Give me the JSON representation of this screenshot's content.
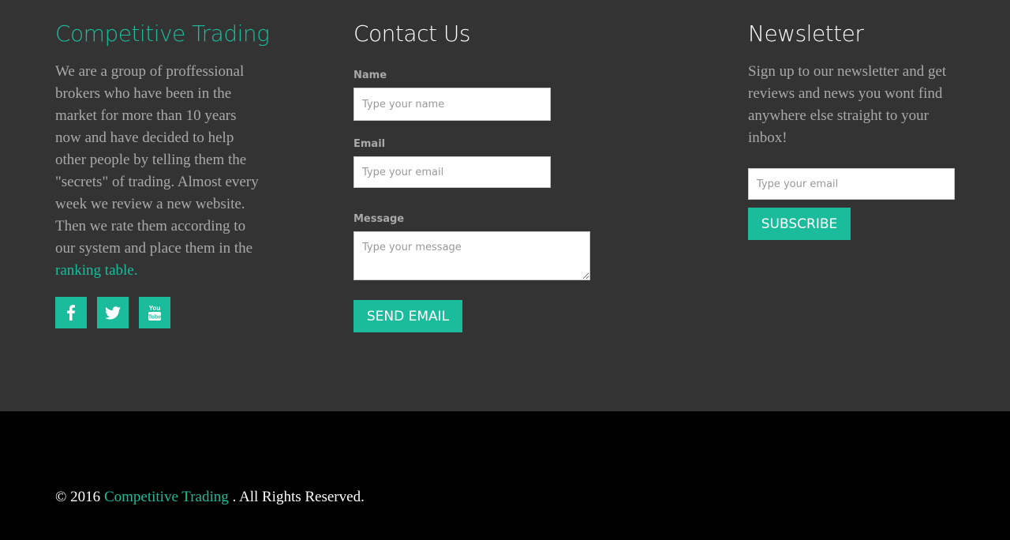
{
  "about": {
    "title": "Competitive Trading",
    "text": "We are a group of proffessional brokers who have been in the market for more than 10 years now and have decided to help other people by telling them the \"secrets\" of trading. Almost every week we review a new website. Then we rate them according to our system and place them in the ",
    "link_text": "ranking table.",
    "social": [
      {
        "icon": "facebook-icon",
        "label": "f"
      },
      {
        "icon": "twitter-icon",
        "label": "twitter"
      },
      {
        "icon": "youtube-icon",
        "label": "You Tube"
      }
    ]
  },
  "contact": {
    "title": "Contact Us",
    "name_label": "Name",
    "name_placeholder": "Type your name",
    "name_value": "",
    "email_label": "Email",
    "email_placeholder": "Type your email",
    "email_value": "",
    "message_label": "Message",
    "message_placeholder": "Type your message",
    "message_value": "",
    "send_label": "SEND EMAIL"
  },
  "newsletter": {
    "title": "Newsletter",
    "text": "Sign up to our newsletter and get reviews and news you wont find anywhere else straight to your inbox!",
    "email_placeholder": "Type your email",
    "email_value": "",
    "subscribe_label": "SUBSCRIBE"
  },
  "footer": {
    "copyright_prefix": "© 2016",
    "brand": "Competitive Trading",
    "copyright_suffix": ". All Rights Reserved."
  },
  "colors": {
    "accent": "#1abc9c",
    "background_top": "#333333",
    "background_bottom": "#000000",
    "body_text": "#a9a9a9"
  }
}
